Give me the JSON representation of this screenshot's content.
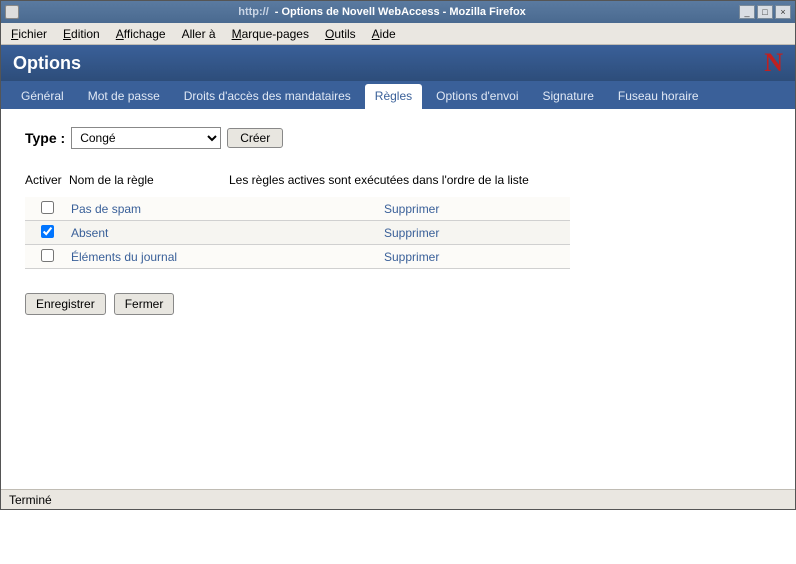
{
  "window": {
    "url": "http://",
    "title": "- Options de Novell WebAccess - Mozilla Firefox",
    "minimize": "_",
    "maximize": "□",
    "close": "×"
  },
  "menu": {
    "fichier": "Fichier",
    "edition": "Edition",
    "affichage": "Affichage",
    "aller": "Aller à",
    "marque": "Marque-pages",
    "outils": "Outils",
    "aide": "Aide"
  },
  "header": {
    "title": "Options",
    "logo": "N"
  },
  "tabs": [
    {
      "label": "Général",
      "active": false
    },
    {
      "label": "Mot de passe",
      "active": false
    },
    {
      "label": "Droits d'accès des mandataires",
      "active": false
    },
    {
      "label": "Règles",
      "active": true
    },
    {
      "label": "Options d'envoi",
      "active": false
    },
    {
      "label": "Signature",
      "active": false
    },
    {
      "label": "Fuseau horaire",
      "active": false
    }
  ],
  "type": {
    "label": "Type :",
    "selected": "Congé",
    "create": "Créer"
  },
  "columns": {
    "activer": "Activer",
    "nom": "Nom de la règle",
    "note": "Les règles actives sont exécutées dans l'ordre de la liste"
  },
  "rules": [
    {
      "checked": false,
      "name": "Pas de spam",
      "action": "Supprimer"
    },
    {
      "checked": true,
      "name": "Absent",
      "action": "Supprimer"
    },
    {
      "checked": false,
      "name": "Éléments du journal",
      "action": "Supprimer"
    }
  ],
  "buttons": {
    "save": "Enregistrer",
    "close": "Fermer"
  },
  "status": "Terminé"
}
